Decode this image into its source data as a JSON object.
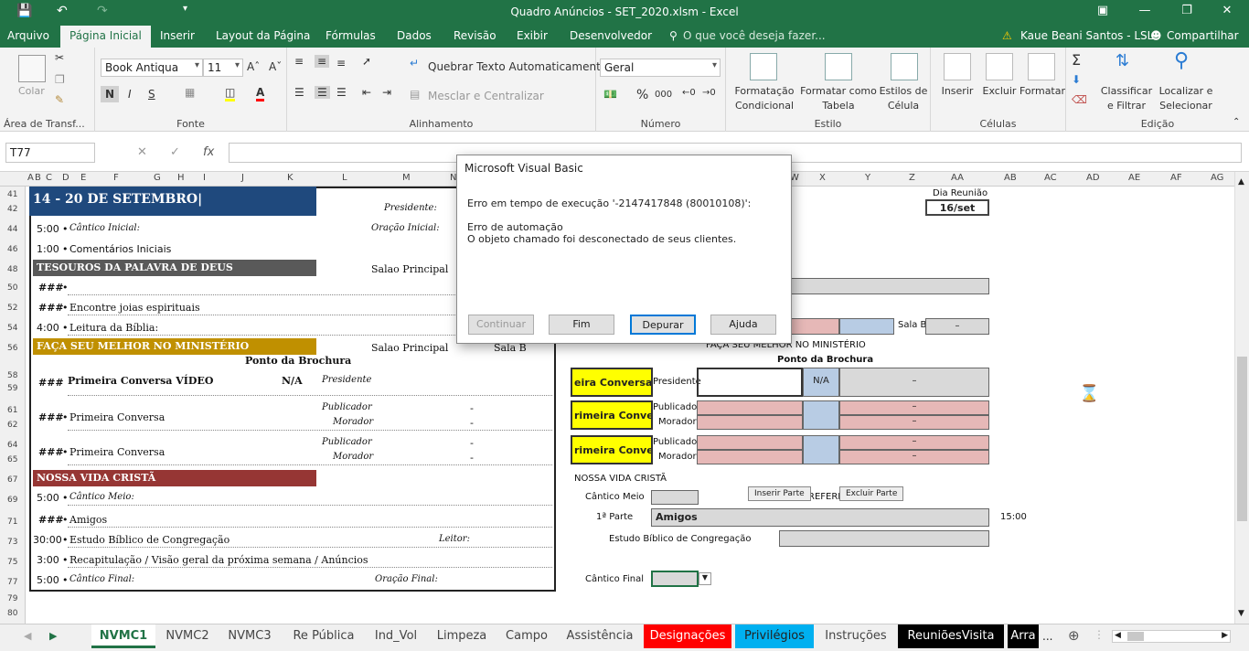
{
  "app": {
    "title": "Quadro Anúncios - SET_2020.xlsm - Excel"
  },
  "ribbon_tabs": [
    "Arquivo",
    "Página Inicial",
    "Inserir",
    "Layout da Página",
    "Fórmulas",
    "Dados",
    "Revisão",
    "Exibir",
    "Desenvolvedor"
  ],
  "tell_me": "O que você deseja fazer...",
  "user": "Kaue Beani Santos - LSL",
  "share": "Compartilhar",
  "ribbon": {
    "clipboard": {
      "paste": "Colar",
      "label": "Área de Transf..."
    },
    "font": {
      "name": "Book Antiqua",
      "size": "11",
      "bold": "N",
      "italic": "I",
      "underline": "S",
      "label": "Fonte"
    },
    "alignment": {
      "wrap": "Quebrar Texto Automaticamente",
      "merge": "Mesclar e Centralizar",
      "label": "Alinhamento"
    },
    "number": {
      "format": "Geral",
      "percent": "%",
      "thousands": "000",
      "label": "Número"
    },
    "styles": {
      "cond1": "Formatação",
      "cond2": "Condicional",
      "table1": "Formatar como",
      "table2": "Tabela",
      "cell1": "Estilos de",
      "cell2": "Célula",
      "label": "Estilo"
    },
    "cells": {
      "insert": "Inserir",
      "delete": "Excluir",
      "format": "Formatar",
      "label": "Células"
    },
    "editing": {
      "sort1": "Classificar",
      "sort2": "e Filtrar",
      "find1": "Localizar e",
      "find2": "Selecionar",
      "label": "Edição"
    }
  },
  "formula_bar": {
    "name_box": "T77",
    "fx": "fx",
    "content": ""
  },
  "columns": [
    "A",
    "B",
    "C",
    "D",
    "E",
    "F",
    "G",
    "H",
    "I",
    "J",
    "K",
    "L",
    "M",
    "N",
    "W",
    "X",
    "Y",
    "Z",
    "AA",
    "AB",
    "AC",
    "AD",
    "AE",
    "AF",
    "AG"
  ],
  "rows": [
    "41",
    "42",
    "44",
    "46",
    "48",
    "50",
    "52",
    "54",
    "56",
    "58",
    "59",
    "61",
    "62",
    "64",
    "65",
    "67",
    "69",
    "71",
    "73",
    "75",
    "77",
    "79",
    "80"
  ],
  "left_panel": {
    "week_title": "14 - 20 DE SETEMBRO|",
    "presidente_label": "Presidente:",
    "opening_song_time": "5:00",
    "opening_song": "Cântico Inicial:",
    "opening_prayer": "Oração Inicial:",
    "intro_time": "1:00",
    "intro": "Comentários Iniciais",
    "treasures": "TESOUROS DA PALAVRA DE DEUS",
    "salao_principal": "Salao Principal",
    "hash": "###",
    "gems": "Encontre joias espirituais",
    "bible_time": "4:00",
    "bible": "Leitura da Bíblia:",
    "ministry": "FAÇA SEU MELHOR NO MINISTÉRIO",
    "sala_b": "Sala B",
    "ponto": "Ponto da Brochura",
    "first_video": "Primeira Conversa VÍDEO",
    "na": "N/A",
    "presidente2": "Presidente",
    "first_conv": "Primeira Conversa",
    "publicador": "Publicador",
    "morador": "Morador",
    "dash": "-",
    "christian": "NOSSA VIDA CRISTÃ",
    "mid_song_time": "5:00",
    "mid_song": "Cântico Meio:",
    "amigos": "Amigos",
    "study_time": "30:00",
    "study": "Estudo Bíblico de Congregação",
    "leitor": "Leitor:",
    "review_time": "3:00",
    "review": "Recapitulação / Visão geral da próxima semana / Anúncios",
    "final_song_time": "5:00",
    "final_song": "Cântico Final:",
    "final_prayer": "Oração Final:"
  },
  "right_panel": {
    "dia_reuniao": "Dia Reunião",
    "date": "16/set",
    "sala_b": "Sala B",
    "dash": "–",
    "ministry": "FAÇA SEU MELHOR NO MINISTÉRIO",
    "ponto": "Ponto da Brochura",
    "conv_v": "eira Conversa V",
    "conv": "rimeira Convers",
    "presidente": "Presidente",
    "na": "N/A",
    "publicado": "Publicado",
    "morador": "Morador",
    "christian": "NOSSA VIDA CRISTÃ",
    "mid_song": "Cântico Meio",
    "insert_part": "Inserir Parte",
    "refere": "REFERÊ",
    "delete_part": "Excluir Parte",
    "part1": "1ª Parte",
    "amigos": "Amigos",
    "time": "15:00",
    "study": "Estudo Bíblico de Congregação",
    "final_song": "Cântico Final"
  },
  "dialog": {
    "title": "Microsoft Visual Basic",
    "line1": "Erro em tempo de execução '-2147417848 (80010108)':",
    "line2": "Erro de automação",
    "line3": "O objeto chamado foi desconectado de seus clientes.",
    "btn_continue": "Continuar",
    "btn_end": "Fim",
    "btn_debug": "Depurar",
    "btn_help": "Ajuda"
  },
  "sheet_tabs": [
    "NVMC1",
    "NVMC2",
    "NVMC3",
    "Re Pública",
    "Ind_Vol",
    "Limpeza",
    "Campo",
    "Assistência",
    "Designações",
    "Privilégios",
    "Instruções",
    "ReuniõesVisita",
    "Arra"
  ],
  "more": "..."
}
